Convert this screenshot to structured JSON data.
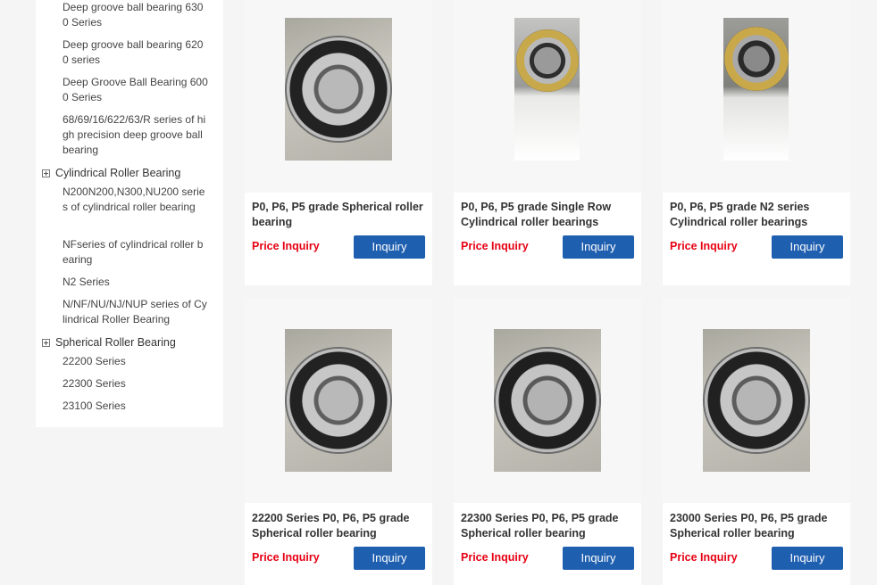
{
  "sidebar": {
    "items": [
      {
        "kind": "link",
        "label": "Deep groove ball bearing 6300 Series"
      },
      {
        "kind": "link",
        "label": "Deep groove ball bearing 6200 series"
      },
      {
        "kind": "link",
        "label": "Deep Groove Ball Bearing 6000 Series"
      },
      {
        "kind": "link",
        "label": "68/69/16/622/63/R series of high precision deep groove ball bearing"
      },
      {
        "kind": "category",
        "label": "Cylindrical Roller Bearing"
      },
      {
        "kind": "link",
        "label": "N200N200,N300,NU200 series of cylindrical roller bearing"
      },
      {
        "kind": "link",
        "label": "NFseries of cylindrical roller bearing"
      },
      {
        "kind": "link",
        "label": "N2 Series"
      },
      {
        "kind": "link",
        "label": "N/NF/NU/NJ/NUP series of Cylindrical Roller Bearing"
      },
      {
        "kind": "category",
        "label": "Spherical Roller Bearing"
      },
      {
        "kind": "link",
        "label": "22200 Series"
      },
      {
        "kind": "link",
        "label": "22300 Series"
      },
      {
        "kind": "link",
        "label": "23100 Series"
      }
    ]
  },
  "products": [
    {
      "title": "P0, P6, P5 grade Spherical roller bearing",
      "price": "Price Inquiry",
      "button": "Inquiry",
      "image": "spherical-roller-bearing-photo"
    },
    {
      "title": "P0, P6, P5 grade Single Row Cylindrical roller bearings",
      "price": "Price Inquiry",
      "button": "Inquiry",
      "image": "cylindrical-roller-bearing-photo"
    },
    {
      "title": "P0, P6, P5 grade N2 series Cylindrical roller bearings",
      "price": "Price Inquiry",
      "button": "Inquiry",
      "image": "cylindrical-roller-bearing-photo"
    },
    {
      "title": "22200 Series P0, P6, P5 grade Spherical roller bearing",
      "price": "Price Inquiry",
      "button": "Inquiry",
      "image": "spherical-roller-bearing-photo"
    },
    {
      "title": "22300 Series P0, P6, P5 grade Spherical roller bearing",
      "price": "Price Inquiry",
      "button": "Inquiry",
      "image": "spherical-roller-bearing-photo"
    },
    {
      "title": "23000 Series P0, P6, P5 grade Spherical roller bearing",
      "price": "Price Inquiry",
      "button": "Inquiry",
      "image": "spherical-roller-bearing-photo"
    }
  ],
  "colors": {
    "accent": "#1f5fb0",
    "price": "#e60012"
  }
}
